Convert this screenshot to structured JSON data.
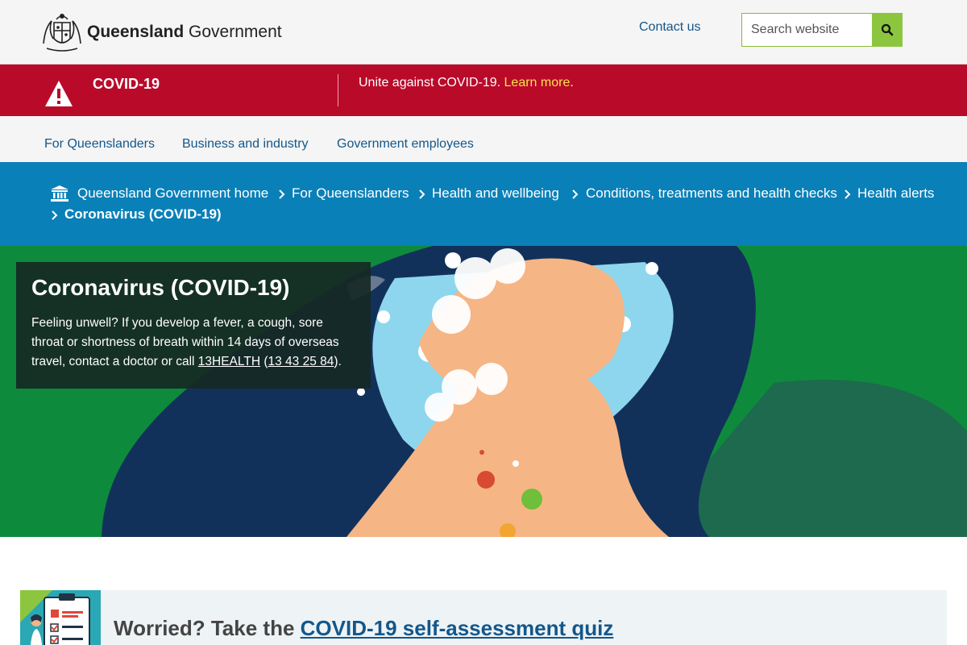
{
  "header": {
    "logo_bold": "Queensland",
    "logo_regular": "Government",
    "contact_label": "Contact us",
    "search_placeholder": "Search website"
  },
  "alert": {
    "title": "COVID-19",
    "message": "Unite against COVID-19.",
    "link_label": "Learn more",
    "link_suffix": "."
  },
  "nav": {
    "items": [
      {
        "label": "For Queenslanders"
      },
      {
        "label": "Business and industry"
      },
      {
        "label": "Government employees"
      }
    ]
  },
  "breadcrumb": {
    "items": [
      {
        "label": "Queensland Government home"
      },
      {
        "label": "For Queenslanders"
      },
      {
        "label": "Health and wellbeing"
      },
      {
        "label": "Conditions, treatments and health checks"
      },
      {
        "label": "Health alerts"
      },
      {
        "label": "Coronavirus (COVID-19)"
      }
    ]
  },
  "hero": {
    "title": "Coronavirus (COVID-19)",
    "text_before": "Feeling unwell? If you develop a fever, a cough, sore throat or shortness of breath within 14 days of overseas travel, contact a doctor or call ",
    "link1": "13HEALTH",
    "text_mid": " (",
    "link2": "13 43 25 84",
    "text_after": ")."
  },
  "quiz": {
    "prefix": "Worried? Take the ",
    "link_label": "COVID-19 self-assessment quiz"
  },
  "colors": {
    "alert_red": "#ba0a2a",
    "breadcrumb_blue": "#0a80b8",
    "link_blue": "#13578b",
    "search_green": "#8cc63f",
    "hero_green": "#0e8a3c",
    "alert_link_yellow": "#f7e24b"
  },
  "icons": [
    "qld-crest-icon",
    "search-icon",
    "warning-icon",
    "home-icon",
    "chevron-right-icon"
  ]
}
